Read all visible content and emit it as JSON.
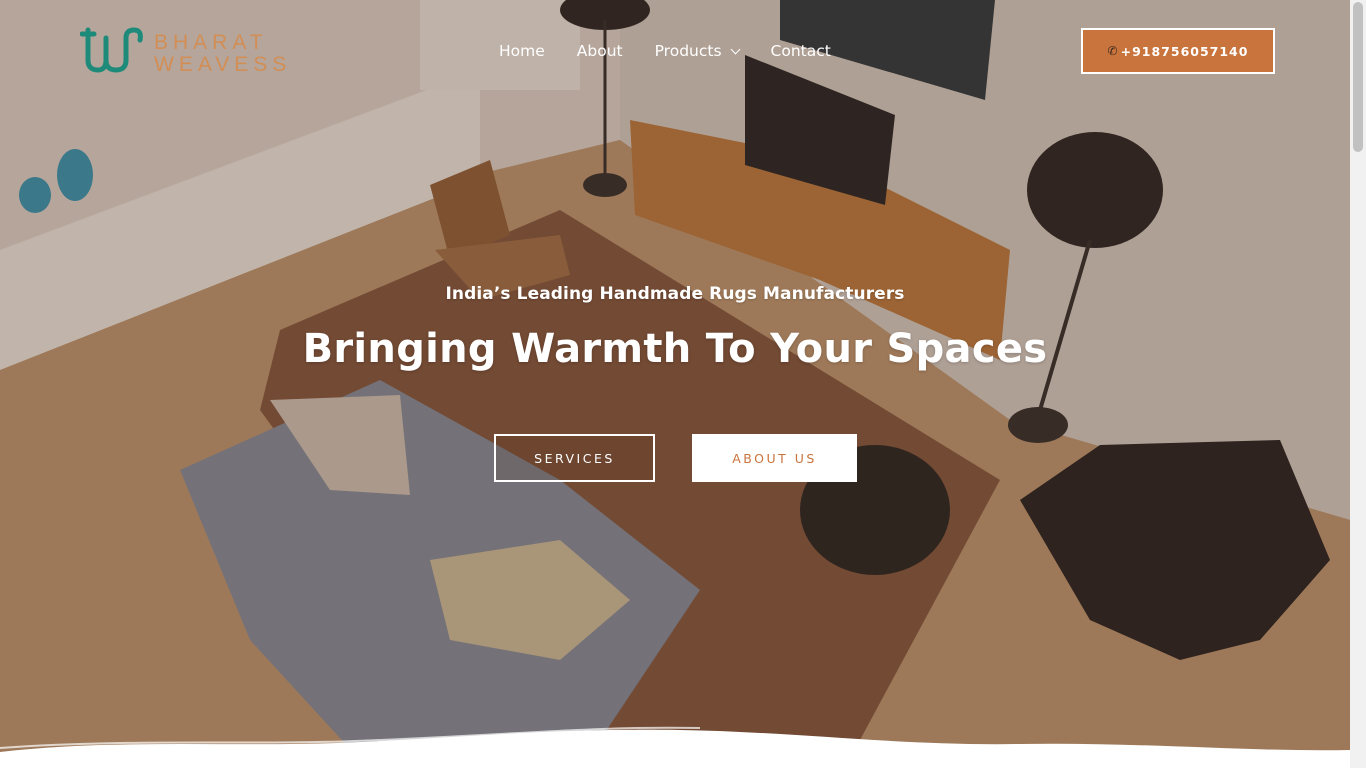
{
  "brand": {
    "logo_line1": "BHARAT",
    "logo_line2": "WEAVESS",
    "accent_color": "#c9743c",
    "logo_mark_color": "#1e8a7a"
  },
  "nav": {
    "items": [
      {
        "label": "Home"
      },
      {
        "label": "About"
      },
      {
        "label": "Products",
        "has_dropdown": true
      },
      {
        "label": "Contact"
      }
    ]
  },
  "header": {
    "phone_label": "+918756057140",
    "phone_icon": "phone-icon"
  },
  "hero": {
    "subtitle": "India’s Leading Handmade Rugs Manufacturers",
    "title": "Bringing Warmth To Your Spaces",
    "services_label": "SERVICES",
    "about_label": "ABOUT US"
  }
}
